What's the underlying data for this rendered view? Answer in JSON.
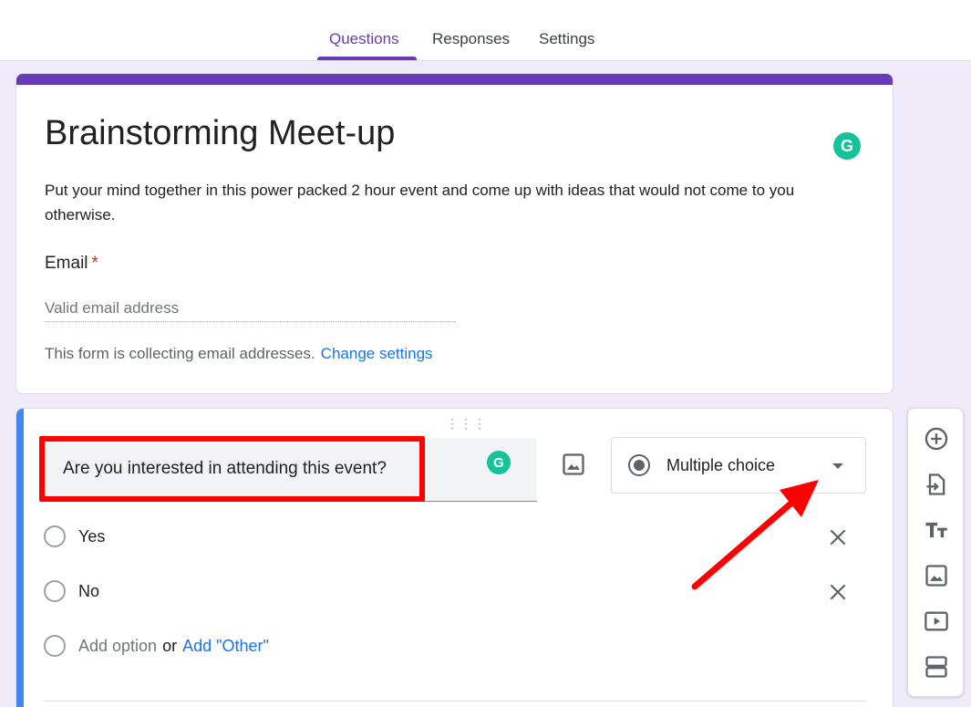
{
  "tabs": [
    {
      "label": "Questions",
      "active": true
    },
    {
      "label": "Responses",
      "active": false
    },
    {
      "label": "Settings",
      "active": false
    }
  ],
  "form": {
    "title": "Brainstorming Meet-up",
    "description": "Put your mind together in this power packed 2 hour event and come up with ideas that would not come to you otherwise.",
    "email_label": "Email",
    "required_mark": "*",
    "email_placeholder": "Valid email address",
    "collect_note": "This form is collecting email addresses.",
    "change_settings": "Change settings",
    "grammarly_glyph": "G"
  },
  "question": {
    "drag_handle": "⋮⋮⋮",
    "text": "Are you interested in attending this event?",
    "type": "Multiple choice",
    "options": [
      "Yes",
      "No"
    ],
    "add_option": "Add option",
    "or": "or",
    "add_other": "Add \"Other\""
  },
  "colors": {
    "accent_purple": "#673ab7",
    "active_blue": "#4285f4",
    "link_blue": "#1a73e8",
    "annotation_red": "#ff0000",
    "grammarly_green": "#15c39a"
  },
  "toolbar_icons": [
    "add-question-icon",
    "import-questions-icon",
    "add-title-icon",
    "add-image-icon",
    "add-video-icon",
    "add-section-icon"
  ]
}
